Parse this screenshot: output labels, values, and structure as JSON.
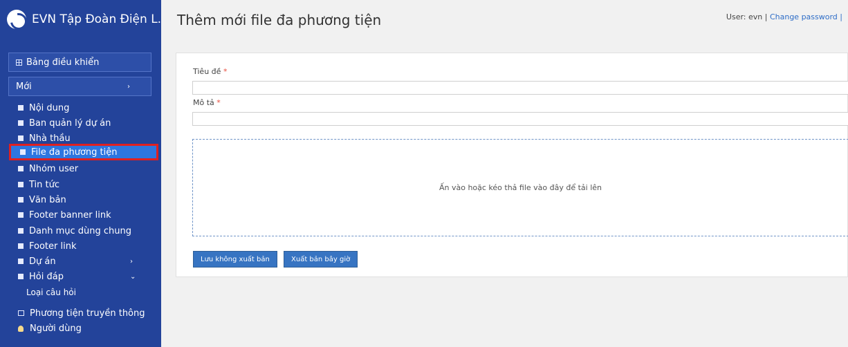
{
  "brand": {
    "title": "EVN Tập Đoàn Điện L..."
  },
  "header": {
    "title": "Thêm mới file đa phương tiện",
    "user_text": "User: evn |",
    "change_password": "Change password |"
  },
  "sidebar": {
    "dashboard": "Bảng điều khiển",
    "new": "Mới",
    "items": [
      "Nội dung",
      "Ban quản lý dự án",
      "Nhà thầu",
      "File đa phương tiện",
      "Nhóm user",
      "Tin tức",
      "Văn bản",
      "Footer banner link",
      "Danh mục dùng chung",
      "Footer link",
      "Dự án",
      "Hỏi đáp"
    ],
    "subitem": "Loại câu hỏi",
    "media": "Phương tiện truyền thông",
    "users": "Người dùng"
  },
  "form": {
    "title_label": "Tiêu đề",
    "description_label": "Mô tả",
    "required_mark": "*",
    "dropzone_text": "Ấn vào hoặc kéo thả file vào đây để tải lên",
    "save_draft": "Lưu không xuất bản",
    "publish_now": "Xuất bản bây giờ"
  }
}
